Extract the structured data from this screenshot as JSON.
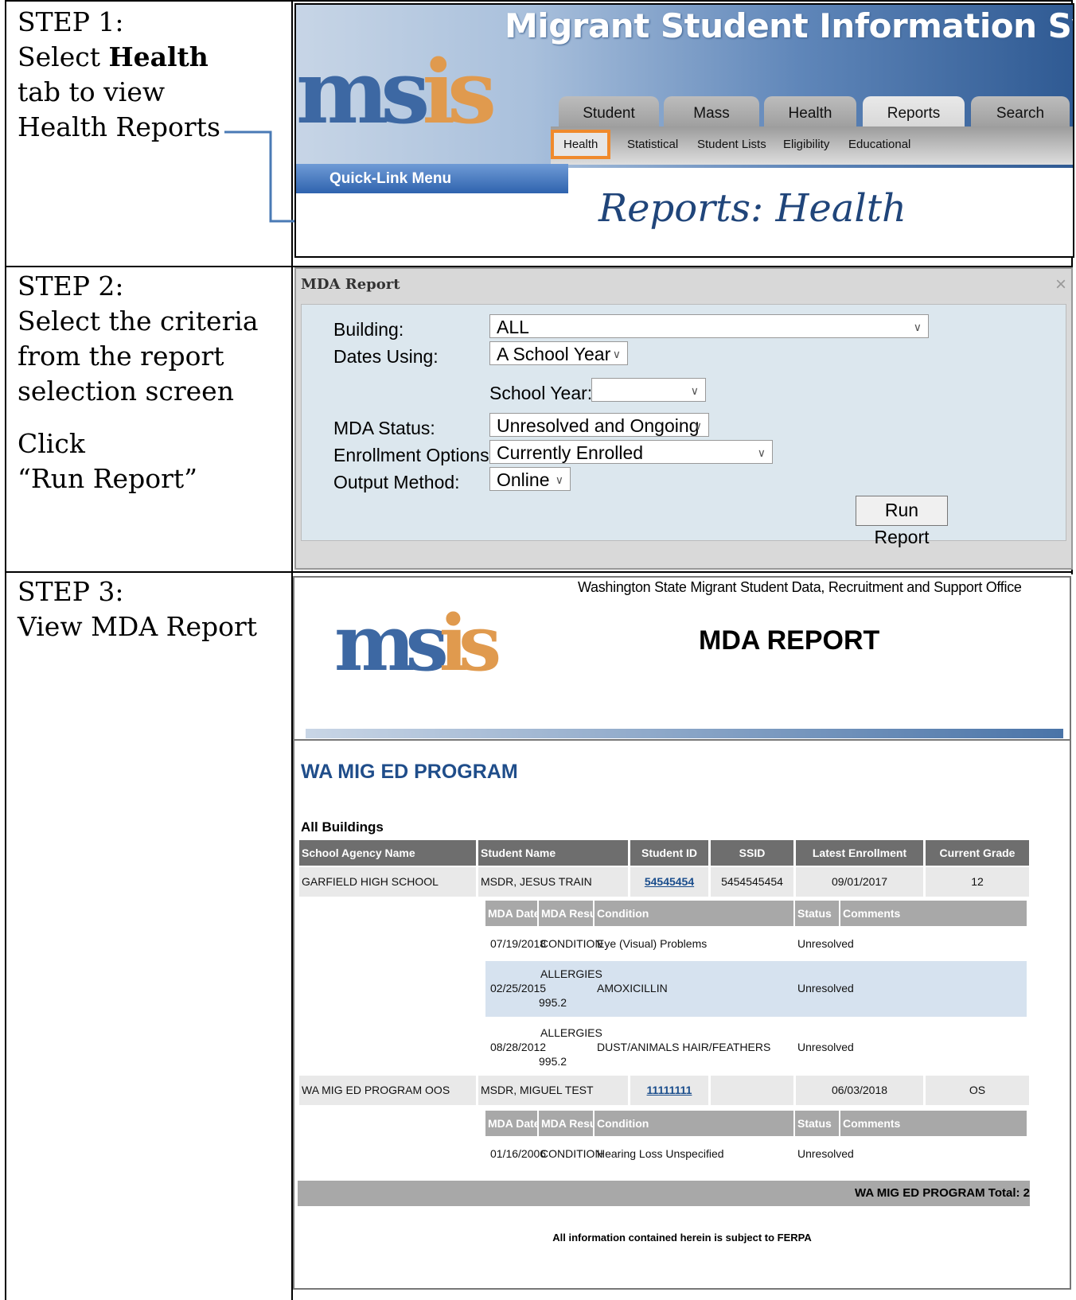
{
  "steps": [
    {
      "lines": [
        "STEP 1:",
        "Select ",
        "Health",
        " tab to view",
        "Health Reports"
      ]
    },
    {
      "lines": [
        "STEP 2:",
        "Select the criteria",
        "from the report",
        "selection screen",
        "Click",
        "“Run Report”"
      ]
    },
    {
      "lines": [
        "STEP 3:",
        "View MDA Report"
      ]
    }
  ],
  "step1": {
    "title": "Migrant Student Information System",
    "logo_main": "ms",
    "logo_accent": "is",
    "tabs": [
      "Student",
      "Mass",
      "Health",
      "Reports",
      "Search"
    ],
    "active_tab": "Reports",
    "subtabs": [
      "Health",
      "Statistical",
      "Student Lists",
      "Eligibility",
      "Educational"
    ],
    "highlighted_subtab": "Health",
    "quick_link": "Quick-Link Menu",
    "page_heading": "Reports: Health",
    "highlight_color": "#f08a2c"
  },
  "step2": {
    "dialog_title": "MDA Report",
    "close": "×",
    "fields": {
      "building_label": "Building:",
      "building_value": "ALL",
      "dates_label": "Dates Using:",
      "dates_value": "A School Year",
      "school_year_label": "School Year:",
      "school_year_value": "",
      "status_label": "MDA Status:",
      "status_value": "Unresolved and Ongoing",
      "enroll_label": "Enrollment Options:",
      "enroll_value": "Currently Enrolled",
      "output_label": "Output Method:",
      "output_value": "Online"
    },
    "run_button": "Run Report"
  },
  "step3": {
    "org": "Washington State Migrant Student Data, Recruitment and Support Office",
    "report_title": "MDA REPORT",
    "program": "WA MIG ED PROGRAM",
    "all_buildings": "All Buildings",
    "headers": [
      "School Agency Name",
      "Student Name",
      "Student ID",
      "SSID",
      "Latest Enrollment",
      "Current Grade"
    ],
    "sub_headers": [
      "MDA Date",
      "MDA Result",
      "Condition",
      "Status",
      "Comments"
    ],
    "students": [
      {
        "school": "GARFIELD HIGH SCHOOL",
        "name": "MSDR, JESUS TRAIN",
        "id": "54545454",
        "ssid": "5454545454",
        "enrollment": "09/01/2017",
        "grade": "12",
        "mda": [
          {
            "date": "07/19/2018",
            "result": "CONDITION",
            "result2": "",
            "condition": "Eye (Visual) Problems",
            "status": "Unresolved"
          },
          {
            "date": "02/25/2015",
            "result": "ALLERGIES",
            "result2": "995.2",
            "condition": "AMOXICILLIN",
            "status": "Unresolved"
          },
          {
            "date": "08/28/2012",
            "result": "ALLERGIES",
            "result2": "995.2",
            "condition": "DUST/ANIMALS HAIR/FEATHERS",
            "status": "Unresolved"
          }
        ]
      },
      {
        "school": "WA MIG ED PROGRAM OOS",
        "name": "MSDR, MIGUEL TEST",
        "id": "11111111",
        "ssid": "",
        "enrollment": "06/03/2018",
        "grade": "OS",
        "mda": [
          {
            "date": "01/16/2006",
            "result": "CONDITION",
            "result2": "",
            "condition": "Hearing Loss Unspecified",
            "status": "Unresolved"
          }
        ]
      }
    ],
    "total": "WA MIG ED PROGRAM Total: 2",
    "footer": "All information contained herein is subject to FERPA"
  }
}
